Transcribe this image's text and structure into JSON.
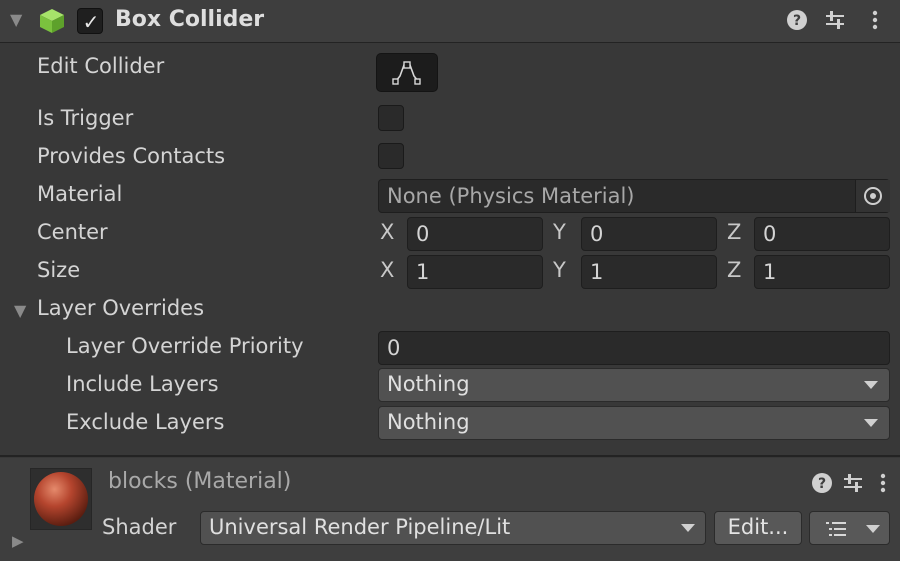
{
  "component": {
    "title": "Box Collider",
    "enabled": true
  },
  "properties": {
    "edit_collider": "Edit Collider",
    "is_trigger": "Is Trigger",
    "provides_contacts": "Provides Contacts",
    "material": "Material",
    "material_value": "None (Physics Material)",
    "center": "Center",
    "size": "Size",
    "center_x": "0",
    "center_y": "0",
    "center_z": "0",
    "size_x": "1",
    "size_y": "1",
    "size_z": "1",
    "axis_x": "X",
    "axis_y": "Y",
    "axis_z": "Z"
  },
  "layer_overrides": {
    "title": "Layer Overrides",
    "priority_label": "Layer Override Priority",
    "priority_value": "0",
    "include_label": "Include Layers",
    "include_value": "Nothing",
    "exclude_label": "Exclude Layers",
    "exclude_value": "Nothing"
  },
  "material_section": {
    "title": "blocks (Material)",
    "shader_label": "Shader",
    "shader_value": "Universal Render Pipeline/Lit",
    "edit_button": "Edit..."
  },
  "colors": {
    "cube_icon": "#8bd14a",
    "sphere": "#b5452e"
  },
  "icons": [
    "foldout-arrow-icon",
    "cube-icon",
    "checkbox-icon",
    "help-icon",
    "presets-icon",
    "more-menu-icon",
    "edit-collider-icon",
    "object-picker-icon",
    "dropdown-caret-icon",
    "material-sphere-icon",
    "list-icon"
  ]
}
